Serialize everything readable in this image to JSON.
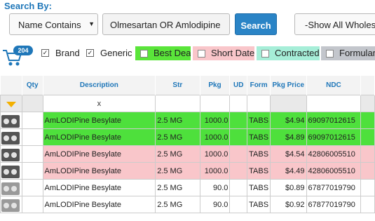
{
  "header": {
    "search_by_label": "Search By:"
  },
  "search": {
    "mode_selected": "Name Contains",
    "query_value": "Olmesartan OR Amlodipine",
    "button_label": "Search",
    "wholesaler_selected": "-Show All Wholesalers-"
  },
  "cart": {
    "count": "204"
  },
  "filters": {
    "brand_label": "Brand",
    "generic_label": "Generic",
    "brand_checked": true,
    "generic_checked": true,
    "chips": [
      {
        "label": "Best Deal",
        "color": "#5ae53a"
      },
      {
        "label": "Short Date",
        "color": "#f9c6ca"
      },
      {
        "label": "Contracted",
        "color": "#a6eed8"
      },
      {
        "label": "Formulary",
        "color": "#c3c6cc"
      }
    ]
  },
  "table": {
    "headers": [
      "",
      "Qty",
      "Description",
      "Str",
      "Pkg",
      "UD",
      "Form",
      "Pkg Price",
      "NDC"
    ],
    "filter_x": "x",
    "rows": [
      {
        "style": "green",
        "desc": "AmLODIPine Besylate",
        "str": "2.5 MG",
        "pkg": "1000.0",
        "ud": "",
        "form": "TABS",
        "price": "$4.94",
        "ndc": "69097012615",
        "img": "dark"
      },
      {
        "style": "green",
        "desc": "AmLODIPine Besylate",
        "str": "2.5 MG",
        "pkg": "1000.0",
        "ud": "",
        "form": "TABS",
        "price": "$4.89",
        "ndc": "69097012615",
        "img": "dark"
      },
      {
        "style": "pink",
        "desc": "AmLODIPine Besylate",
        "str": "2.5 MG",
        "pkg": "1000.0",
        "ud": "",
        "form": "TABS",
        "price": "$4.54",
        "ndc": "42806005510",
        "img": "dark"
      },
      {
        "style": "pink",
        "desc": "AmLODIPine Besylate",
        "str": "2.5 MG",
        "pkg": "1000.0",
        "ud": "",
        "form": "TABS",
        "price": "$4.49",
        "ndc": "42806005510",
        "img": "dark"
      },
      {
        "style": "white",
        "desc": "AmLODIPine Besylate",
        "str": "2.5 MG",
        "pkg": "90.0",
        "ud": "",
        "form": "TABS",
        "price": "$0.89",
        "ndc": "67877019790",
        "img": "light"
      },
      {
        "style": "white",
        "desc": "AmLODIPine Besylate",
        "str": "2.5 MG",
        "pkg": "90.0",
        "ud": "",
        "form": "TABS",
        "price": "$0.92",
        "ndc": "67877019790",
        "img": "light"
      }
    ]
  }
}
